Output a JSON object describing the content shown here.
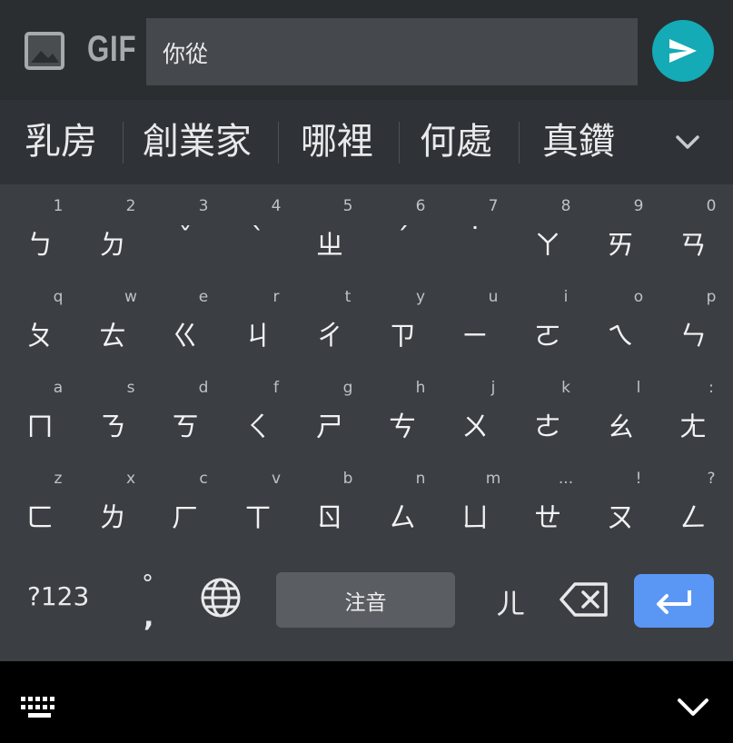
{
  "top_bar": {
    "gif_label": "GIF",
    "input_text": "你從",
    "image_icon": "image-icon",
    "send_icon": "send-icon"
  },
  "suggestions": [
    "乳房",
    "創業家",
    "哪裡",
    "何處",
    "真鑽"
  ],
  "keyboard": {
    "rows": [
      [
        {
          "hint": "1",
          "glyph": "ㄅ"
        },
        {
          "hint": "2",
          "glyph": "ㄉ"
        },
        {
          "hint": "3",
          "glyph": "ˇ"
        },
        {
          "hint": "4",
          "glyph": "ˋ"
        },
        {
          "hint": "5",
          "glyph": "ㄓ"
        },
        {
          "hint": "6",
          "glyph": "ˊ"
        },
        {
          "hint": "7",
          "glyph": "˙"
        },
        {
          "hint": "8",
          "glyph": "ㄚ"
        },
        {
          "hint": "9",
          "glyph": "ㄞ"
        },
        {
          "hint": "0",
          "glyph": "ㄢ"
        }
      ],
      [
        {
          "hint": "q",
          "glyph": "ㄆ"
        },
        {
          "hint": "w",
          "glyph": "ㄊ"
        },
        {
          "hint": "e",
          "glyph": "ㄍ"
        },
        {
          "hint": "r",
          "glyph": "ㄐ"
        },
        {
          "hint": "t",
          "glyph": "ㄔ"
        },
        {
          "hint": "y",
          "glyph": "ㄗ"
        },
        {
          "hint": "u",
          "glyph": "ㄧ"
        },
        {
          "hint": "i",
          "glyph": "ㄛ"
        },
        {
          "hint": "o",
          "glyph": "ㄟ"
        },
        {
          "hint": "p",
          "glyph": "ㄣ"
        }
      ],
      [
        {
          "hint": "a",
          "glyph": "ㄇ"
        },
        {
          "hint": "s",
          "glyph": "ㄋ"
        },
        {
          "hint": "d",
          "glyph": "ㄎ"
        },
        {
          "hint": "f",
          "glyph": "ㄑ"
        },
        {
          "hint": "g",
          "glyph": "ㄕ"
        },
        {
          "hint": "h",
          "glyph": "ㄘ"
        },
        {
          "hint": "j",
          "glyph": "ㄨ"
        },
        {
          "hint": "k",
          "glyph": "ㄜ"
        },
        {
          "hint": "l",
          "glyph": "ㄠ"
        },
        {
          "hint": ":",
          "glyph": "ㄤ"
        }
      ],
      [
        {
          "hint": "z",
          "glyph": "ㄈ"
        },
        {
          "hint": "x",
          "glyph": "ㄌ"
        },
        {
          "hint": "c",
          "glyph": "ㄏ"
        },
        {
          "hint": "v",
          "glyph": "ㄒ"
        },
        {
          "hint": "b",
          "glyph": "ㄖ"
        },
        {
          "hint": "n",
          "glyph": "ㄙ"
        },
        {
          "hint": "m",
          "glyph": "ㄩ"
        },
        {
          "hint": "...",
          "glyph": "ㄝ"
        },
        {
          "hint": "!",
          "glyph": "ㄡ"
        },
        {
          "hint": "?",
          "glyph": "ㄥ"
        }
      ]
    ],
    "bottom": {
      "symbols_label": "?123",
      "punct_top": "°",
      "punct_bottom": ",",
      "globe_icon": "globe-icon",
      "space_label": "注音",
      "er_label": "ㄦ",
      "backspace_icon": "backspace-icon",
      "enter_icon": "enter-icon"
    }
  },
  "nav": {
    "keyboard_icon": "keyboard-icon",
    "hide_icon": "chevron-down-icon"
  },
  "colors": {
    "accent_send": "#14aab6",
    "accent_enter": "#5a96f4",
    "keyboard_bg": "#3b3e42"
  }
}
